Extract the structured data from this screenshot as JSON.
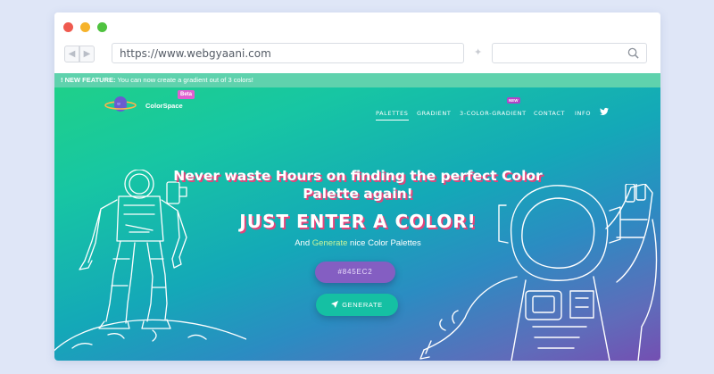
{
  "browser": {
    "url": "https://www.webgyaani.com",
    "star": "✦"
  },
  "announcement": {
    "prefix": "! NEW FEATURE:",
    "text": " You can now create a gradient out of 3 colors!"
  },
  "nav": {
    "brand": "ColorSpace",
    "beta_badge": "Beta",
    "items": [
      {
        "label": "PALETTES"
      },
      {
        "label": "GRADIENT"
      },
      {
        "label": "3-COLOR-GRADIENT"
      },
      {
        "label": "CONTACT"
      },
      {
        "label": "INFO"
      }
    ],
    "new_badge": "NEW"
  },
  "hero": {
    "headline_line1": "Never waste Hours on finding the perfect Color",
    "headline_line2": "Palette again!",
    "enter": "JUST ENTER A COLOR!",
    "sub_prefix": "And ",
    "sub_highlight": "Generate",
    "sub_suffix": " nice Color Palettes",
    "color_value": "#845EC2",
    "generate_label": "GENERATE"
  },
  "colors": {
    "accent_purple": "#845ec2",
    "accent_teal": "#15c0a3",
    "announce_bar": "#5fd2ad",
    "text_shadow": "#e2457b"
  }
}
